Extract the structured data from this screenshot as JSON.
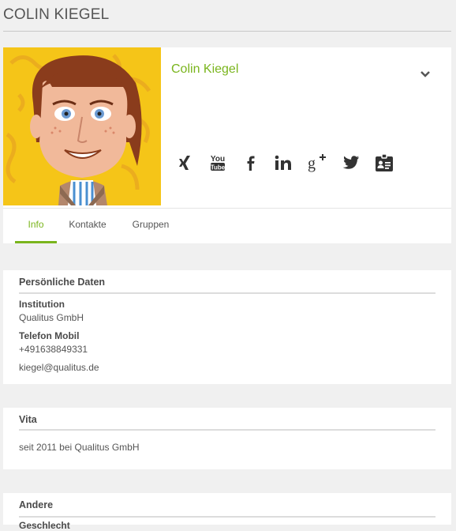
{
  "page": {
    "title": "COLIN KIEGEL"
  },
  "profile": {
    "name": "Colin Kiegel",
    "avatar_icon": "cartoon-avatar",
    "menu_icon": "chevron-down-icon",
    "social": [
      "xing-icon",
      "youtube-icon",
      "facebook-icon",
      "linkedin-icon",
      "google-plus-icon",
      "twitter-icon",
      "contact-card-icon"
    ]
  },
  "tabs": [
    {
      "label": "Info",
      "active": true
    },
    {
      "label": "Kontakte",
      "active": false
    },
    {
      "label": "Gruppen",
      "active": false
    }
  ],
  "personal": {
    "heading": "Persönliche Daten",
    "institution_label": "Institution",
    "institution_value": "Qualitus GmbH",
    "phone_label": "Telefon Mobil",
    "phone_value": "+491638849331",
    "email": "kiegel@qualitus.de"
  },
  "vita": {
    "heading": "Vita",
    "text": "seit 2011 bei Qualitus GmbH"
  },
  "other": {
    "heading": "Andere",
    "next_label": "Geschlecht"
  },
  "colors": {
    "accent": "#7ab51d",
    "avatar_bg": "#f5c518",
    "text": "#555555"
  }
}
